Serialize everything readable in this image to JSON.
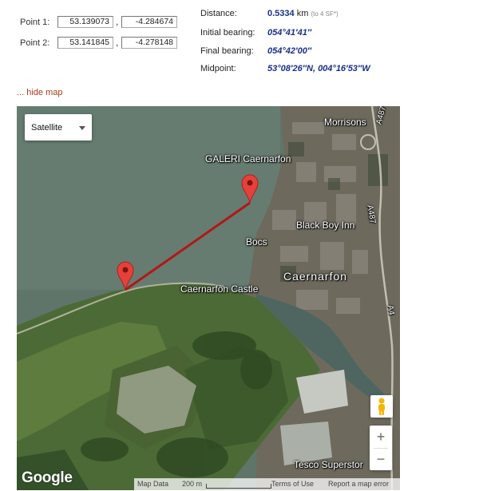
{
  "point1": {
    "label": "Point 1:",
    "lat": "53.139073",
    "lon": "-4.284674"
  },
  "point2": {
    "label": "Point 2:",
    "lat": "53.141845",
    "lon": "-4.278148"
  },
  "separator": ",",
  "results": {
    "distance": {
      "label": "Distance:",
      "value": "0.5334",
      "unit": "km",
      "note": "(to 4 SF*)"
    },
    "initial_bearing": {
      "label": "Initial bearing:",
      "value": "054°41′41″"
    },
    "final_bearing": {
      "label": "Final bearing:",
      "value": "054°42′00″"
    },
    "midpoint": {
      "label": "Midpoint:",
      "value": "53°08′26″N, 004°16′53″W"
    }
  },
  "hide_map_link": "... hide map",
  "map": {
    "type_selector": "Satellite",
    "labels": {
      "morrisons": "Morrisons",
      "a487_top": "A487",
      "galeri": "GALERI Caernarfon",
      "black_boy": "Black Boy Inn",
      "bocs": "Bocs",
      "a487_right": "A487",
      "caernarfon": "Caernarfon",
      "castle": "Caernarfon Castle",
      "a4_partial": "A4",
      "tesco": "Tesco Superstor"
    },
    "zoom_in": "+",
    "zoom_out": "−",
    "logo": "Google",
    "footer": {
      "map_data": "Map Data",
      "scale": "200 m",
      "terms": "Terms of Use",
      "report": "Report a map error"
    },
    "route_color": "#b01818",
    "marker_color": "#e5413a"
  }
}
